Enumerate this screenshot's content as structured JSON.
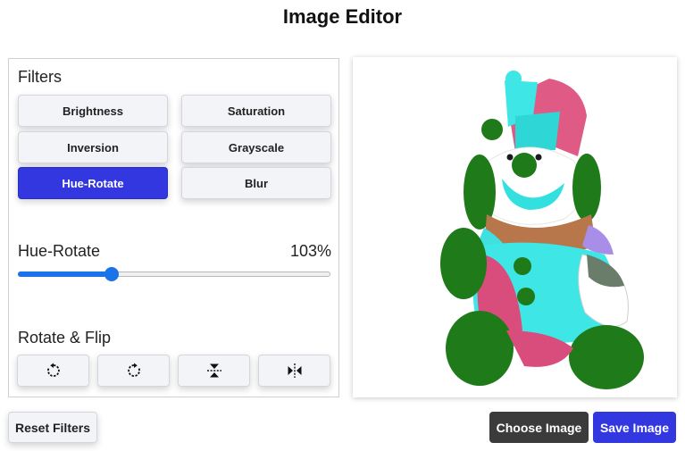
{
  "app": {
    "title": "Image Editor"
  },
  "filters": {
    "label": "Filters",
    "buttons": [
      {
        "label": "Brightness",
        "active": false
      },
      {
        "label": "Saturation",
        "active": false
      },
      {
        "label": "Inversion",
        "active": false
      },
      {
        "label": "Grayscale",
        "active": false
      },
      {
        "label": "Hue-Rotate",
        "active": true
      },
      {
        "label": "Blur",
        "active": false
      }
    ],
    "active_color": "#3337e0"
  },
  "slider": {
    "name": "Hue-Rotate",
    "value_text": "103%",
    "fraction": 0.3,
    "accent": "#1a73e8"
  },
  "rotate_flip": {
    "label": "Rotate & Flip",
    "buttons": [
      {
        "icon": "rotate-left-icon"
      },
      {
        "icon": "rotate-right-icon"
      },
      {
        "icon": "flip-vertical-icon"
      },
      {
        "icon": "flip-horizontal-icon"
      }
    ]
  },
  "preview": {
    "subject": "clown-plush-toy-image"
  },
  "actions": {
    "reset_label": "Reset Filters",
    "choose_label": "Choose Image",
    "save_label": "Save Image"
  }
}
